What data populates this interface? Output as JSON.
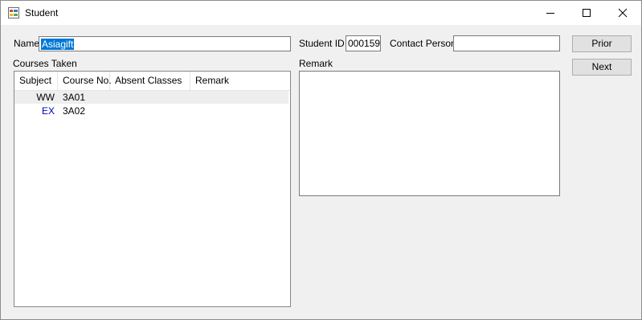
{
  "window": {
    "title": "Student",
    "icon": "app-form-icon"
  },
  "form": {
    "name_label": "Name",
    "name_value": "Asiagift",
    "student_id_label": "Student ID",
    "student_id_value": "000159",
    "contact_label": "Contact Person",
    "contact_value": "",
    "courses_label": "Courses Taken",
    "remark_label": "Remark",
    "remark_value": ""
  },
  "buttons": {
    "prior": "Prior",
    "next": "Next"
  },
  "courses": {
    "columns": [
      "Subject",
      "Course No.",
      "Absent Classes",
      "Remark"
    ],
    "rows": [
      {
        "subject": "WW",
        "course_no": "3A01",
        "absent": "",
        "remark": ""
      },
      {
        "subject": "EX",
        "course_no": "3A02",
        "absent": "",
        "remark": ""
      }
    ]
  },
  "colors": {
    "selection": "#0078d7",
    "ex_text": "#0000c0",
    "row_highlight": "#eeeeee"
  }
}
